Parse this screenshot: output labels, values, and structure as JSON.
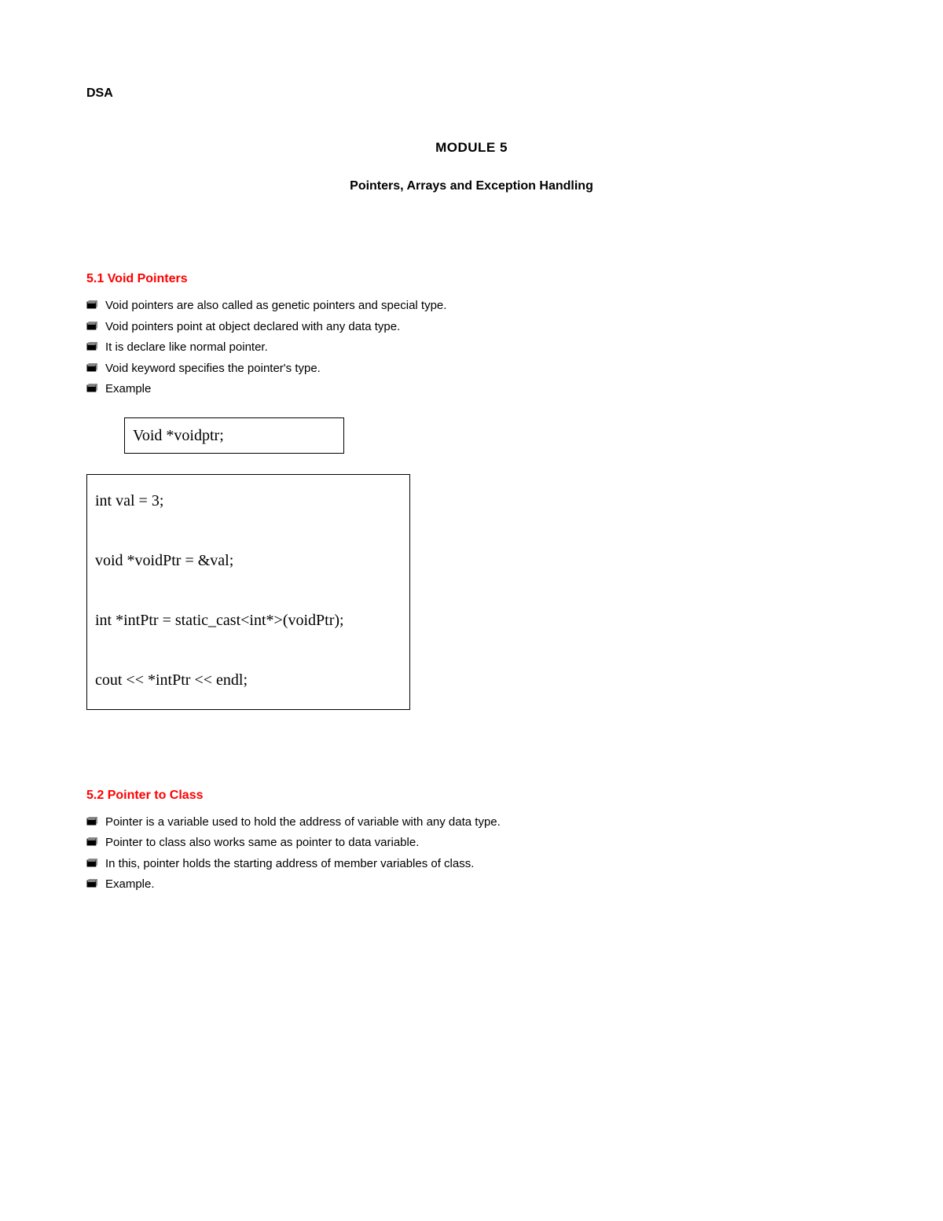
{
  "header": {
    "label": "DSA"
  },
  "module": {
    "title": "MODULE 5",
    "subtitle": "Pointers, Arrays and Exception Handling"
  },
  "section1": {
    "heading": "5.1 Void Pointers",
    "items": [
      "Void pointers are also called as genetic pointers and special type.",
      "Void pointers point at object declared with any data type.",
      "It is declare like normal pointer.",
      "Void keyword specifies the pointer's type.",
      "Example"
    ],
    "code_small": "Void *voidptr;",
    "code_large": {
      "l1": "int val = 3;",
      "l2": "void *voidPtr = &val;",
      "l3": "int *intPtr = static_cast<int*>(voidPtr);",
      "l4": "cout << *intPtr << endl;"
    }
  },
  "section2": {
    "heading": "5.2 Pointer to Class",
    "items": [
      "Pointer is a variable used to hold the address of variable with any data type.",
      "Pointer to class also works same as pointer to data variable.",
      "In this, pointer holds the starting address of member variables of class.",
      "Example."
    ]
  }
}
